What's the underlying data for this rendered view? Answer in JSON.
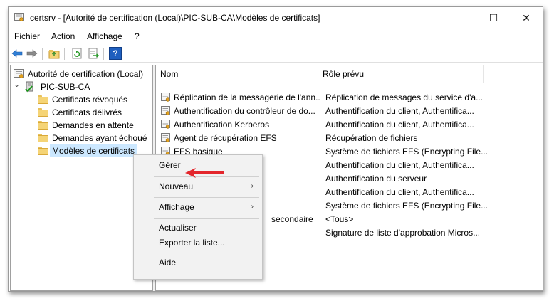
{
  "window": {
    "title": "certsrv - [Autorité de certification (Local)\\PIC-SUB-CA\\Modèles de certificats]",
    "controls": {
      "minimize": "—",
      "maximize": "☐",
      "close": "✕"
    }
  },
  "menu": [
    "Fichier",
    "Action",
    "Affichage",
    "?"
  ],
  "toolbar": {
    "buttons": [
      "back-arrow-icon",
      "forward-arrow-icon",
      "up-folder-icon",
      "refresh-icon",
      "export-list-icon",
      "help-icon"
    ],
    "help_label": "?"
  },
  "tree": {
    "root": "Autorité de certification (Local)",
    "ca": "PIC-SUB-CA",
    "expander": "⌄",
    "items": [
      "Certificats révoqués",
      "Certificats délivrés",
      "Demandes en attente",
      "Demandes ayant échoué",
      "Modèles de certificats"
    ],
    "selected": "Modèles de certificats"
  },
  "list": {
    "columns": [
      "Nom",
      "Rôle prévu"
    ],
    "rows": [
      {
        "name": "Réplication de la messagerie de l'ann...",
        "role": "Réplication de messages du service d'a..."
      },
      {
        "name": "Authentification du contrôleur de do...",
        "role": "Authentification du client, Authentifica..."
      },
      {
        "name": "Authentification Kerberos",
        "role": "Authentification du client, Authentifica..."
      },
      {
        "name": "Agent de récupération EFS",
        "role": "Récupération de fichiers"
      },
      {
        "name": "EFS basique",
        "role": "Système de fichiers EFS (Encrypting File..."
      },
      {
        "name": "",
        "role": "Authentification du client, Authentifica..."
      },
      {
        "name": "",
        "role": "Authentification du serveur"
      },
      {
        "name": "",
        "role": "Authentification du client, Authentifica..."
      },
      {
        "name": "",
        "role": "Système de fichiers EFS (Encrypting File..."
      },
      {
        "name": "secondaire",
        "role": "<Tous>"
      },
      {
        "name": "",
        "role": "Signature de liste d'approbation Micros..."
      }
    ]
  },
  "context_menu": {
    "items": [
      {
        "label": "Gérer",
        "submenu": false
      },
      {
        "label": "Nouveau",
        "submenu": true
      },
      {
        "label": "Affichage",
        "submenu": true
      },
      {
        "label": "Actualiser",
        "submenu": false
      },
      {
        "label": "Exporter la liste...",
        "submenu": false
      },
      {
        "label": "Aide",
        "submenu": false
      }
    ],
    "submenu_glyph": "›"
  },
  "colors": {
    "selection": "#cce8ff",
    "annotation_arrow": "#e3262c",
    "menu_bg": "#f2f2f2"
  }
}
